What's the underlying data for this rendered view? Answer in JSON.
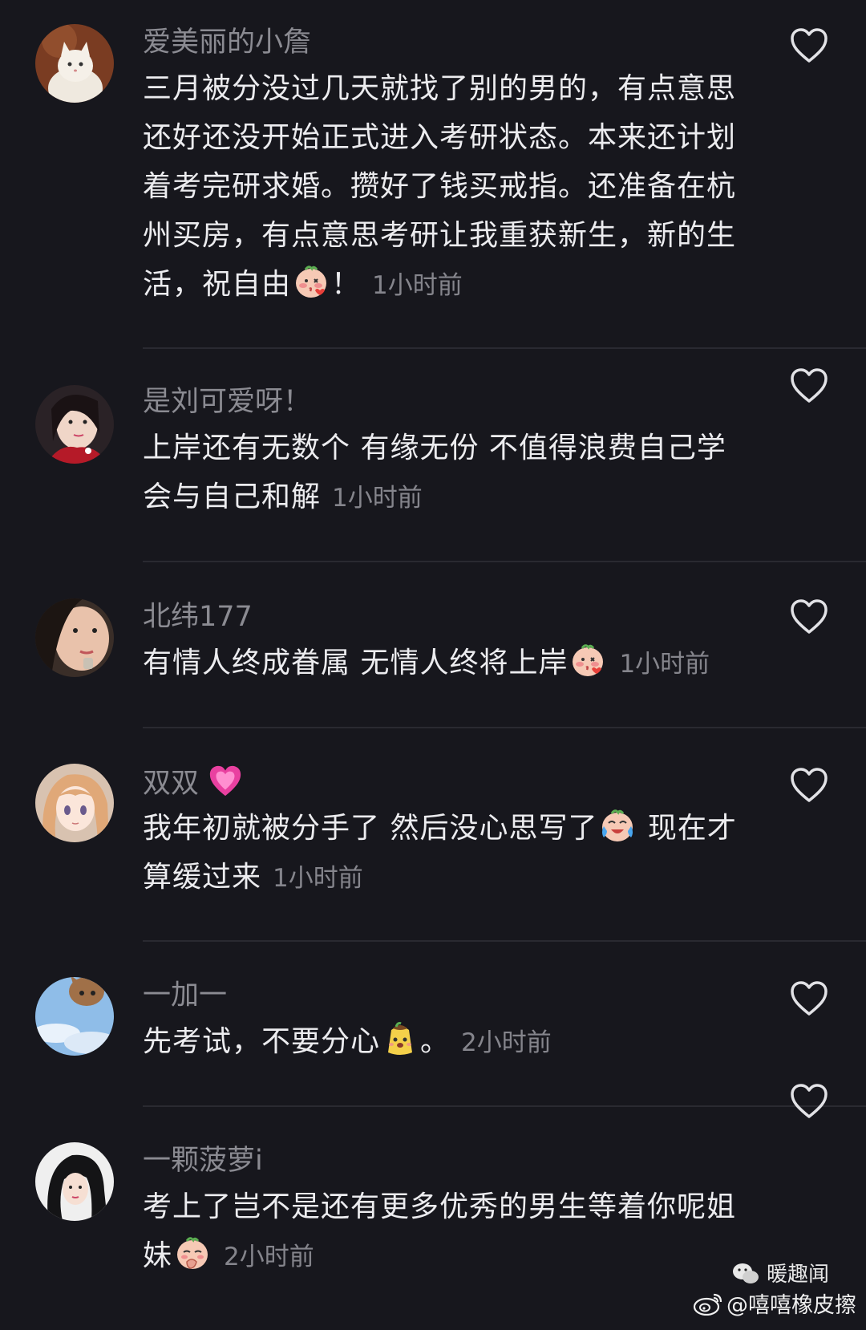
{
  "comments": [
    {
      "username": "爱美丽的小詹",
      "text": "三月被分没过几天就找了别的男的，有点意思还好还没开始正式进入考研状态。本来还计划着考完研求婚。攒好了钱买戒指。还准备在杭州买房，有点意思考研让我重获新生，新的生活，祝自由",
      "text_after": "！",
      "emoji": "blush-kiss-emoji",
      "time": "1小时前",
      "avatar": "white-cat-avatar"
    },
    {
      "username": "是刘可爱呀！",
      "text": "上岸还有无数个 有缘无份 不值得浪费自己学会与自己和解",
      "time": "1小时前",
      "avatar": "girl-red-scarf-avatar"
    },
    {
      "username": "北纬177",
      "text": "有情人终成眷属 无情人终将上岸",
      "emoji": "blush-kiss-emoji",
      "time": "1小时前",
      "avatar": "girl-closeup-avatar"
    },
    {
      "username": "双双",
      "username_emoji": "pink-heart-emoji",
      "text": "我年初就被分手了 然后没心思写了",
      "emoji": "crying-laugh-emoji",
      "text_after": " 现在才算缓过来",
      "time": "1小时前",
      "avatar": "anime-girl-avatar"
    },
    {
      "username": "一加一",
      "text": "先考试，不要分心",
      "emoji": "pudding-emoji",
      "text_after": "。",
      "time": "2小时前",
      "avatar": "cat-sky-avatar"
    },
    {
      "username": "一颗菠萝i",
      "text": "考上了岂不是还有更多优秀的男生等着你呢姐妹",
      "emoji": "thinking-blush-emoji",
      "time": "2小时前",
      "avatar": "woman-dark-hair-avatar"
    }
  ],
  "watermark": {
    "top": "暖趣闻",
    "bottom": "@嘻嘻橡皮擦"
  },
  "colors": {
    "background": "#17171d",
    "username": "#8b8b92",
    "text": "#ececef",
    "time": "#85858c"
  }
}
